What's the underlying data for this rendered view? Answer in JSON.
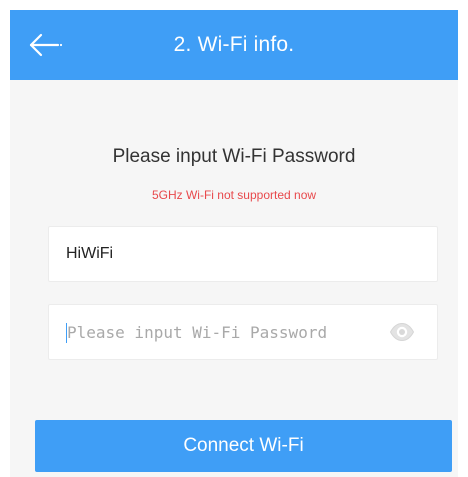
{
  "header": {
    "title": "2. Wi-Fi info.",
    "back_icon": "back-arrow-icon",
    "background_color": "#3f9ef6"
  },
  "form": {
    "heading": "Please input Wi-Fi Password",
    "warning": "5GHz Wi-Fi not supported now",
    "warning_color": "#e8494c",
    "ssid_value": "HiWiFi",
    "password_value": "",
    "password_placeholder": "Please input Wi-Fi Password",
    "visibility_icon": "eye-icon"
  },
  "actions": {
    "connect_label": "Connect Wi-Fi",
    "button_color": "#3f9ef6"
  }
}
